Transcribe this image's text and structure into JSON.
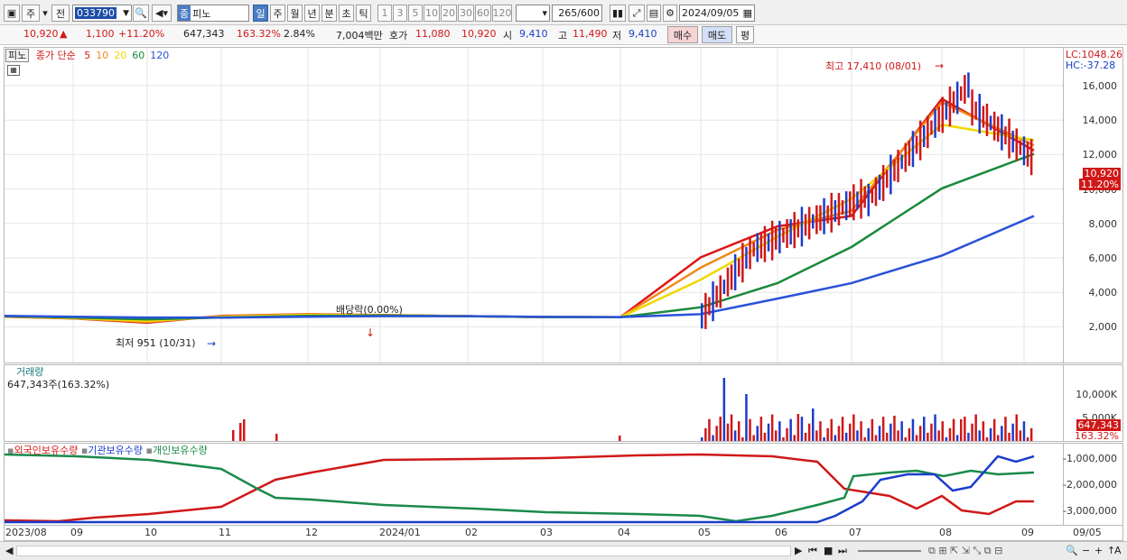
{
  "toolbar": {
    "market_a": "주",
    "market_b": "전",
    "stock_code": "033790",
    "stock_tag": "종",
    "stock_name": "피노",
    "periods": [
      "일",
      "주",
      "월",
      "년",
      "분",
      "초",
      "틱"
    ],
    "active_period": "일",
    "intervals": [
      "1",
      "3",
      "5",
      "10",
      "20",
      "30",
      "60",
      "120"
    ],
    "count_value": "265",
    "count_total": "/600",
    "date": "2024/09/05"
  },
  "quote": {
    "price": "10,920",
    "change": "1,100",
    "change_pct": "+11.20%",
    "volume": "647,343",
    "volume_ratio": "163.32%",
    "turnover": "2.84%",
    "amount": "7,004백만",
    "bid_label": "호가",
    "bid1": "11,080",
    "bid2": "10,920",
    "open_label": "시",
    "open": "9,410",
    "high_label": "고",
    "high": "11,490",
    "low_label": "저",
    "low": "9,410",
    "buy_button": "매수",
    "sell_button": "매도",
    "eval_button": "평"
  },
  "price_panel": {
    "name_tag": "피노",
    "legend_title": "종가 단순",
    "ma_periods": [
      "5",
      "10",
      "20",
      "60",
      "120"
    ],
    "ma_colors": [
      "#e01515",
      "#f08a1c",
      "#f0d800",
      "#1a8a3a",
      "#2a52d8"
    ],
    "lc_label": "LC:1048.26",
    "hc_label": "HC:-37.28",
    "yticks": [
      "16,000",
      "14,000",
      "12,000",
      "10,000",
      "8,000",
      "6,000",
      "4,000",
      "2,000"
    ],
    "current_price_badge": "10,920",
    "current_pct_badge": "11.20%",
    "high_annotation": "최고 17,410 (08/01)",
    "low_annotation": "최저 951 (10/31)",
    "dividend_annotation": "배당락(0.00%)"
  },
  "volume_panel": {
    "title": "거래량",
    "value": "647,343주(163.32%)",
    "yticks": [
      "10,000K",
      "5,000K"
    ],
    "badge_value": "647,343",
    "badge_pct": "163.32%"
  },
  "holding_panel": {
    "legends": [
      "외국인보유수량",
      "기관보유수량",
      "개인보유수량"
    ],
    "legend_colors": [
      "#d01818",
      "#1a3dcc",
      "#1a8a4a"
    ],
    "yticks": [
      "-1,000,000",
      "-2,000,000",
      "-3,000,000"
    ]
  },
  "x_axis": [
    "2023/08",
    "09",
    "10",
    "11",
    "12",
    "2024/01",
    "02",
    "03",
    "04",
    "05",
    "06",
    "07",
    "08",
    "09",
    "09/05"
  ],
  "chart_data": {
    "type": "line",
    "x": [
      "2023/08",
      "2023/09",
      "2023/10",
      "2023/11",
      "2023/12",
      "2024/01",
      "2024/02",
      "2024/03",
      "2024/04",
      "2024/05",
      "2024/06",
      "2024/07",
      "2024/08",
      "2024/09"
    ],
    "series": [
      {
        "name": "5",
        "values": [
          1350,
          1250,
          1000,
          1400,
          1500,
          1450,
          1380,
          1330,
          1320,
          4800,
          6600,
          7200,
          14000,
          11000
        ]
      },
      {
        "name": "10",
        "values": [
          1360,
          1260,
          1050,
          1380,
          1480,
          1440,
          1380,
          1330,
          1320,
          4200,
          6400,
          7500,
          13800,
          11300
        ]
      },
      {
        "name": "20",
        "values": [
          1370,
          1270,
          1100,
          1350,
          1460,
          1430,
          1380,
          1330,
          1320,
          3500,
          6000,
          8200,
          12500,
          11600
        ]
      },
      {
        "name": "60",
        "values": [
          1380,
          1300,
          1200,
          1300,
          1400,
          1420,
          1380,
          1330,
          1320,
          1900,
          3300,
          5400,
          8800,
          10800
        ]
      },
      {
        "name": "120",
        "values": [
          1400,
          1350,
          1300,
          1300,
          1350,
          1380,
          1380,
          1340,
          1330,
          1500,
          2400,
          3300,
          4900,
          7200
        ]
      }
    ],
    "ylim": [
      0,
      17500
    ]
  }
}
